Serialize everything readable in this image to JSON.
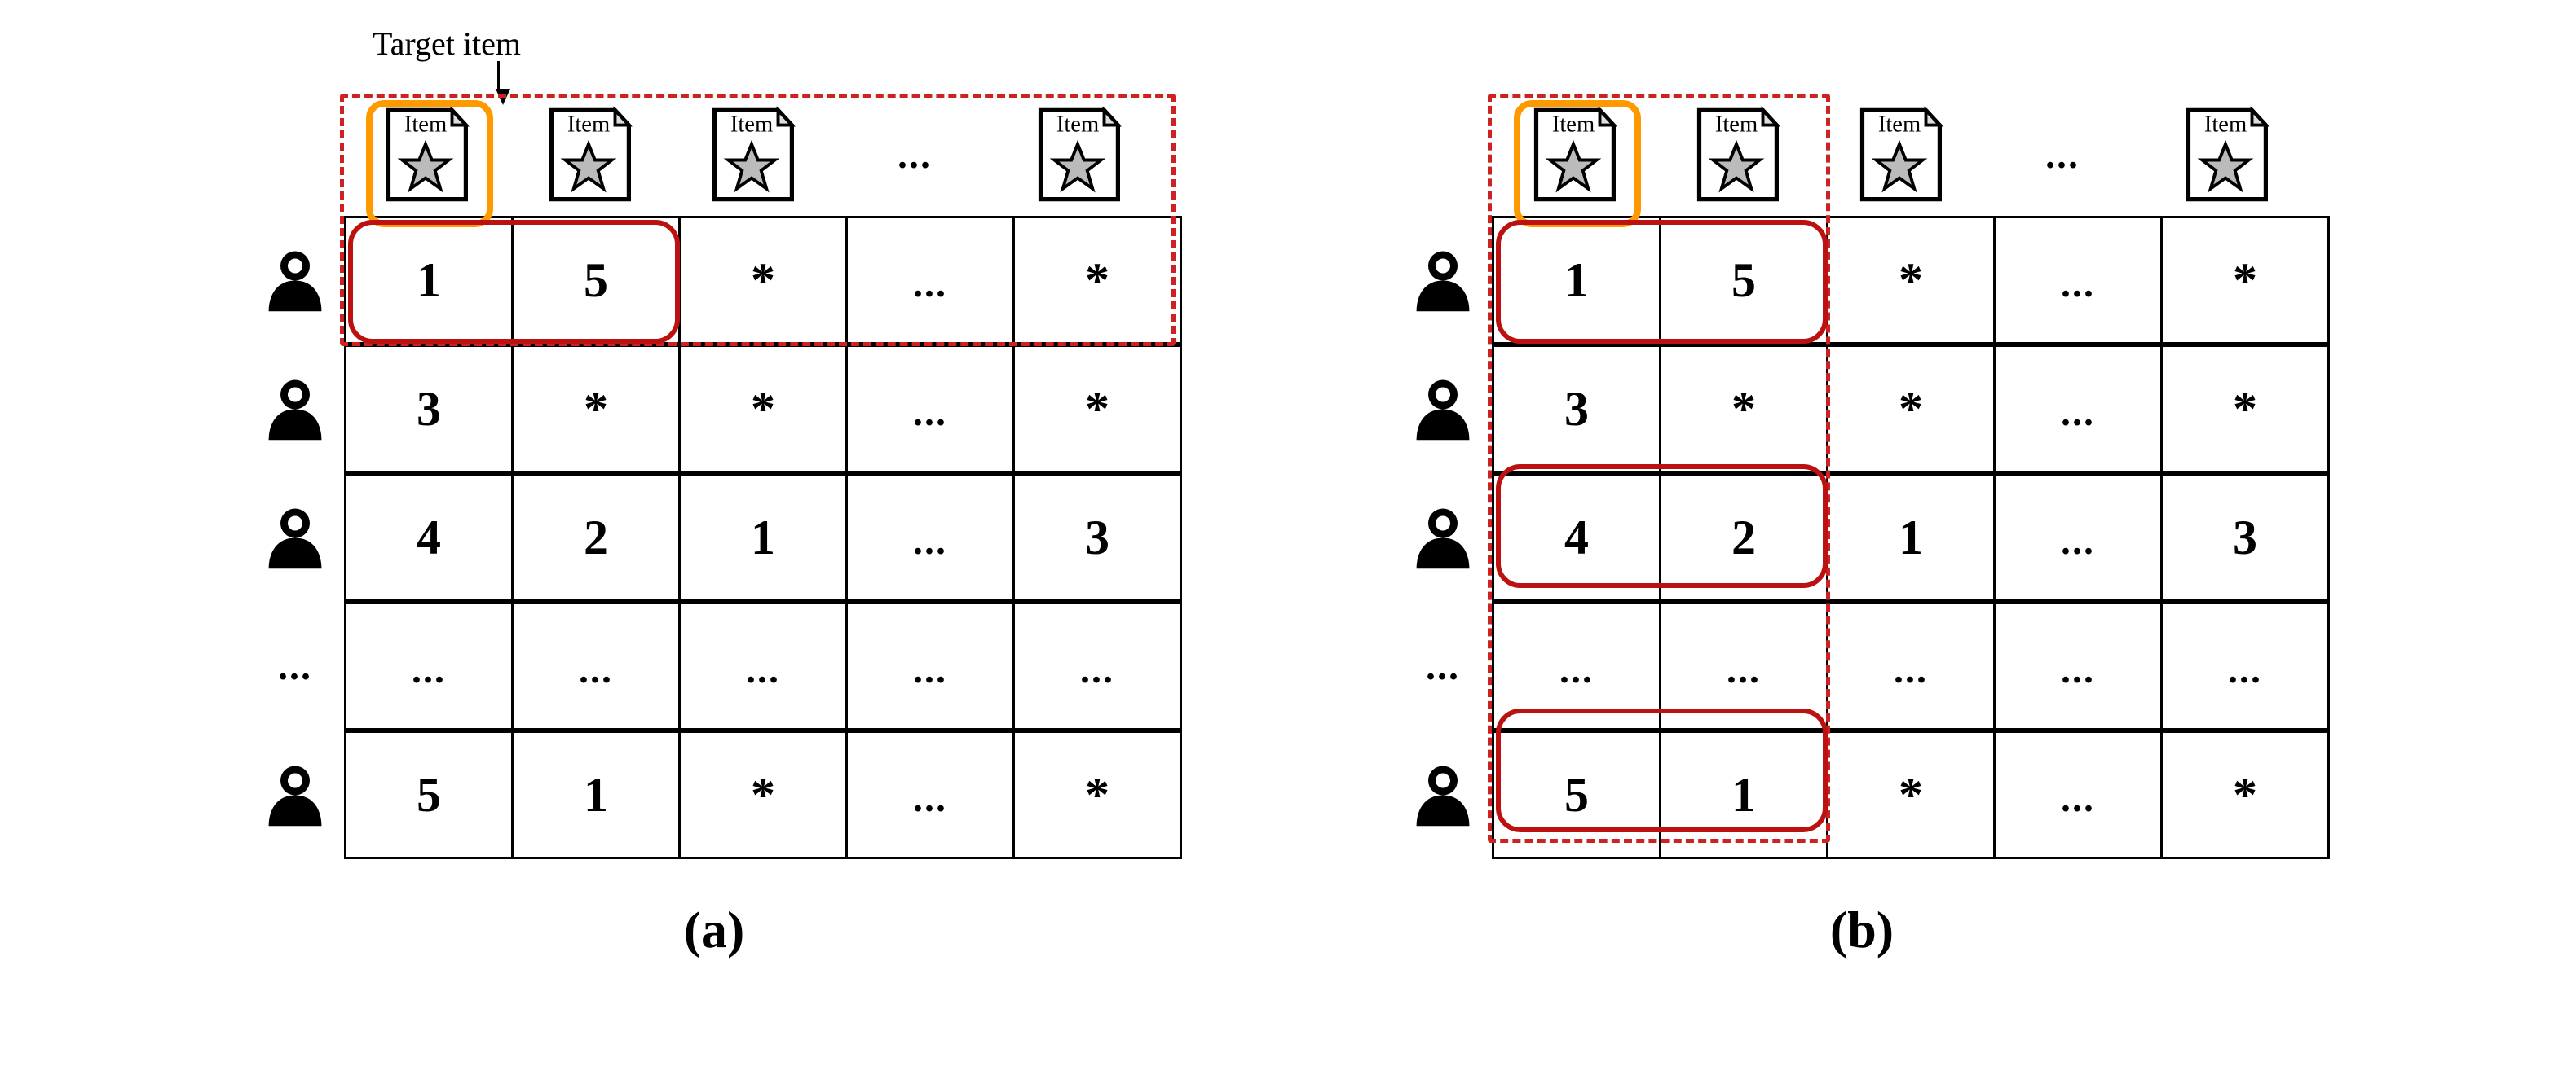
{
  "target_label": "Target item",
  "item_header_label": "Item",
  "row_ellipsis": "...",
  "captions": {
    "a": "(a)",
    "b": "(b)"
  },
  "panel_a": {
    "items": [
      "Item",
      "Item",
      "Item",
      "...",
      "Item"
    ],
    "rows": [
      [
        "1",
        "5",
        "*",
        "...",
        "*"
      ],
      [
        "3",
        "*",
        "*",
        "...",
        "*"
      ],
      [
        "4",
        "2",
        "1",
        "...",
        "3"
      ],
      [
        "...",
        "...",
        "...",
        "...",
        "..."
      ],
      [
        "5",
        "1",
        "*",
        "...",
        "*"
      ]
    ],
    "users": [
      "user",
      "user",
      "user",
      "...",
      "user"
    ]
  },
  "panel_b": {
    "items": [
      "Item",
      "Item",
      "Item",
      "...",
      "Item"
    ],
    "rows": [
      [
        "1",
        "5",
        "*",
        "...",
        "*"
      ],
      [
        "3",
        "*",
        "*",
        "...",
        "*"
      ],
      [
        "4",
        "2",
        "1",
        "...",
        "3"
      ],
      [
        "...",
        "...",
        "...",
        "...",
        "..."
      ],
      [
        "5",
        "1",
        "*",
        "...",
        "*"
      ]
    ],
    "users": [
      "user",
      "user",
      "user",
      "...",
      "user"
    ]
  },
  "chart_data": [
    {
      "type": "table",
      "id": "a",
      "title": "(a) User-based / row-wise view of user-item rating matrix",
      "target_item_index": 0,
      "dashed_selection": "first row (target user) + item headers",
      "solid_selection": [
        [
          0,
          0
        ],
        [
          0,
          1
        ]
      ],
      "columns": [
        "item1",
        "item2",
        "item3",
        "...",
        "itemN"
      ],
      "rows_label": [
        "user1",
        "user2",
        "user3",
        "...",
        "userM"
      ],
      "data": [
        [
          1,
          5,
          null,
          "...",
          null
        ],
        [
          3,
          null,
          null,
          "...",
          null
        ],
        [
          4,
          2,
          1,
          "...",
          3
        ],
        [
          "...",
          "...",
          "...",
          "...",
          "..."
        ],
        [
          5,
          1,
          null,
          "...",
          null
        ]
      ]
    },
    {
      "type": "table",
      "id": "b",
      "title": "(b) Item-based / column-wise view of user-item rating matrix",
      "target_item_index": 0,
      "dashed_selection": "first two columns (target item + neighbour item)",
      "solid_selection": [
        [
          0,
          0
        ],
        [
          0,
          1
        ],
        [
          2,
          0
        ],
        [
          2,
          1
        ],
        [
          4,
          0
        ],
        [
          4,
          1
        ]
      ],
      "columns": [
        "item1",
        "item2",
        "item3",
        "...",
        "itemN"
      ],
      "rows_label": [
        "user1",
        "user2",
        "user3",
        "...",
        "userM"
      ],
      "data": [
        [
          1,
          5,
          null,
          "...",
          null
        ],
        [
          3,
          null,
          null,
          "...",
          null
        ],
        [
          4,
          2,
          1,
          "...",
          3
        ],
        [
          "...",
          "...",
          "...",
          "...",
          "..."
        ],
        [
          5,
          1,
          null,
          "...",
          null
        ]
      ]
    }
  ]
}
